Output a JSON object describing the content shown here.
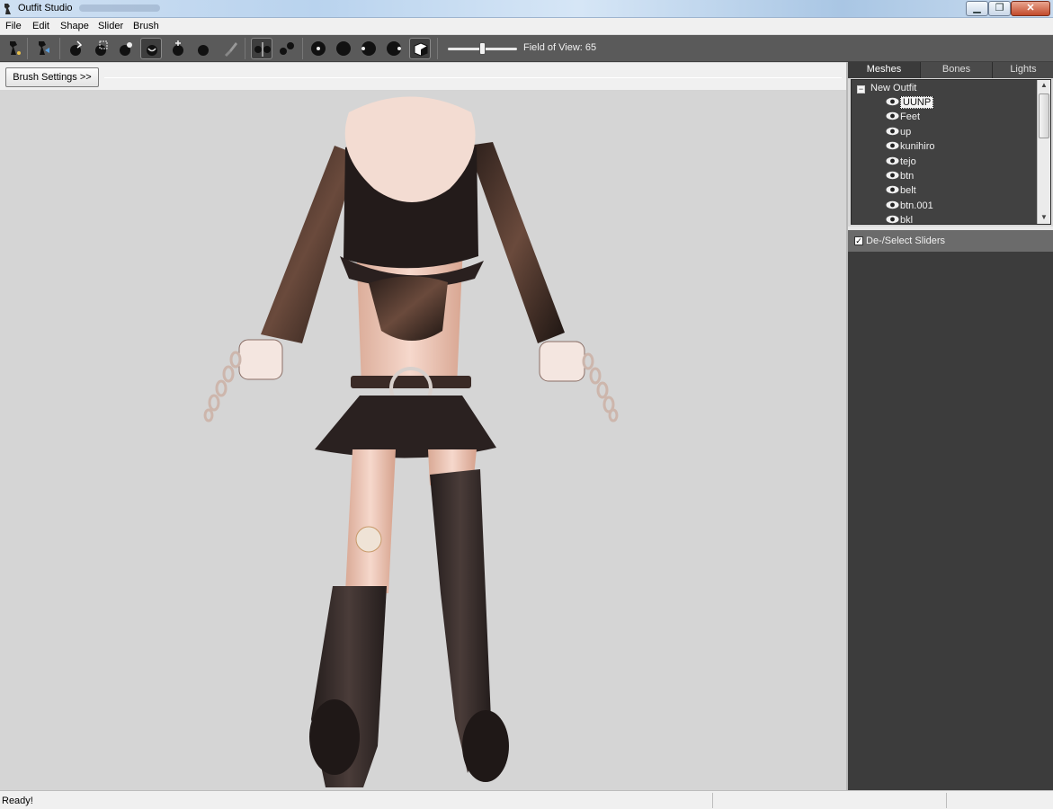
{
  "window": {
    "title": "Outfit Studio"
  },
  "menu": {
    "items": [
      "File",
      "Edit",
      "Shape",
      "Slider",
      "Brush"
    ]
  },
  "toolbar": {
    "fov_label": "Field of View: 65",
    "fov_value": 65
  },
  "brush": {
    "settings_label": "Brush Settings >>"
  },
  "panel": {
    "tabs": [
      "Meshes",
      "Bones",
      "Lights"
    ],
    "active_tab": "Meshes",
    "root": "New Outfit",
    "meshes": [
      "UUNP",
      "Feet",
      "up",
      "kunihiro",
      "tejo",
      "btn",
      "belt",
      "btn.001",
      "bkl"
    ],
    "selected_mesh": "UUNP",
    "sliders_toggle_label": "De-/Select Sliders",
    "sliders_toggle_checked": true
  },
  "status": {
    "text": "Ready!"
  }
}
